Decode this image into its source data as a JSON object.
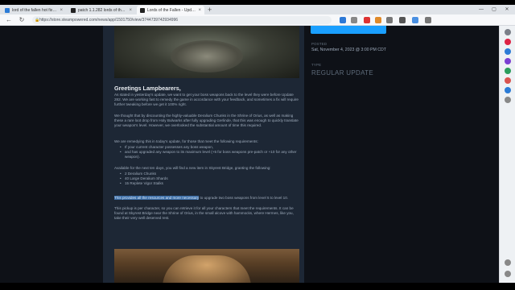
{
  "tabs": [
    {
      "title": "lord of the fallen hot fix - Search"
    },
    {
      "title": "patch 1.1.282 lords of the fallen - ..."
    },
    {
      "title": "Lords of the Fallen - Update v.1..."
    }
  ],
  "address_bar": {
    "url": "https://store.steampowered.com/news/app/1501750/view/3744739742934996"
  },
  "article": {
    "heading": "Greetings Lampbearers,",
    "para1": "As stated in yesterday's update, we want to get your boss weapons back to the level they were before Update 282. We are working fast to remedy the game in accordance with your feedback, and sometimes a fix will require further tweaking before we get it 100% right.",
    "para2": "We thought that by discounting the highly-valuable Deralium Chunks in the Shrine of Orius, as well as making these a rare loot drop from Holy Bulwarks after fully upgrading Gerlinde, that this was enough to quickly translate your weapon's level. However, we overlooked the substantial amount of time this required.",
    "para3": "We are remedying this in today's update, for those that meet the following requirements:",
    "req1": "If your current character possesses any boss weapon,",
    "req2": "and has upgraded any weapon to its maximum level (+5 for boss weapons pre-patch or +10 for any other weapon).",
    "para4": "Available for the next ten days, you will find a new item in Skyrest Bridge, granting the following:",
    "item1": "2 Deralium Chunks",
    "item2": "40 Large Deralium Shards",
    "item3": "15 Replete Vigor Stalks",
    "para5_highlight": "This provides all the resources and more necessary",
    "para5_rest": " to upgrade two boss weapons from level 5 to level 10.",
    "para6": "This pickup is per character, so you can retrieve it for all your characters that meet the requirements. It can be found at Skyrest Bridge near the Shrine of Orius, in the small alcove with hammocks, where Hermes, like you, take their very well deserved rest."
  },
  "sidebar_info": {
    "posted_label": "POSTED",
    "posted_value": "Sat, November 4, 2023 @ 3:00 PM CDT",
    "type_label": "TYPE",
    "type_value": "REGULAR UPDATE"
  },
  "colors": {
    "steam_blue": "#1a9fff",
    "article_bg": "#1d2735",
    "highlight": "#3d6fa8"
  }
}
